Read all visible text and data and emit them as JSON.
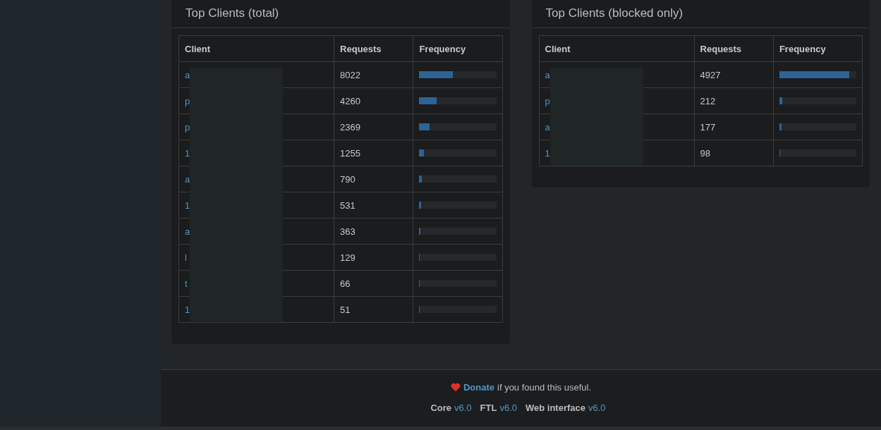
{
  "panels": [
    {
      "title": "Top Clients (total)",
      "columns": [
        "Client",
        "Requests",
        "Frequency"
      ],
      "rows": [
        {
          "client": "a",
          "requests": "8022",
          "level": 0.44
        },
        {
          "client": "p",
          "requests": "4260",
          "level": 0.23
        },
        {
          "client": "p",
          "requests": "2369",
          "level": 0.13
        },
        {
          "client": "1",
          "requests": "1255",
          "level": 0.065
        },
        {
          "client": "a",
          "requests": "790",
          "level": 0.035
        },
        {
          "client": "1",
          "requests": "531",
          "level": 0.025
        },
        {
          "client": "a",
          "requests": "363",
          "level": 0.015
        },
        {
          "client": "l",
          "requests": "129",
          "level": 0.006
        },
        {
          "client": "t",
          "requests": "66",
          "level": 0.004
        },
        {
          "client": "1",
          "requests": "51",
          "level": 0.003
        }
      ]
    },
    {
      "title": "Top Clients (blocked only)",
      "columns": [
        "Client",
        "Requests",
        "Frequency"
      ],
      "rows": [
        {
          "client": "a",
          "requests": "4927",
          "level": 0.91
        },
        {
          "client": "p",
          "requests": "212",
          "level": 0.04
        },
        {
          "client": "a",
          "requests": "177",
          "level": 0.03
        },
        {
          "client": "1",
          "requests": "98",
          "level": 0.01
        }
      ]
    }
  ],
  "footer": {
    "donate_link": "Donate",
    "donate_text": "if you found this useful.",
    "versions": [
      {
        "name": "Core",
        "version": "v6.0"
      },
      {
        "name": "FTL",
        "version": "v6.0"
      },
      {
        "name": "Web interface",
        "version": "v6.0"
      }
    ]
  }
}
